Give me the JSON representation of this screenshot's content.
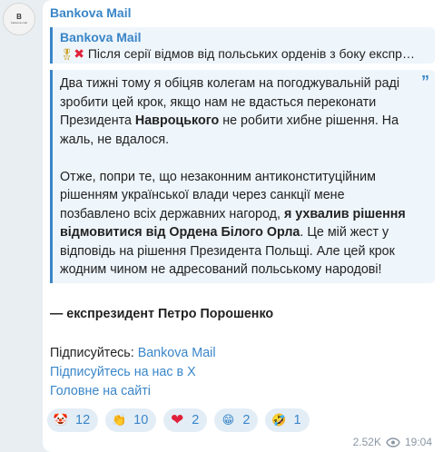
{
  "channel": {
    "avatar_text": "B",
    "avatar_sub": "bankova mail"
  },
  "post": {
    "sender": "Bankova Mail",
    "reply": {
      "title": "Bankova Mail",
      "text": "Після серії відмов від польських орденів з боку експр…"
    },
    "quote": {
      "p1_a": "Два тижні тому я обіцяв колегам на погоджувальній раді зробити цей крок, якщо нам не вдасться переконати Президента ",
      "p1_bold": "Навроцького",
      "p1_b": " не робити хибне рішення. На жаль, не вдалося.",
      "p2_a": "Отже, попри те, що незаконним антиконституційним рішенням української влади через санкції мене позбавлено всіх державних нагород, ",
      "p2_bold": "я ухвалив рішення відмовитися від Ордена Білого Орла",
      "p2_b": ". Це мій жест у відповідь на рішення Президента Польщі. Але цей крок жодним чином не адресований польському народові!"
    },
    "signature": "— експрезидент Петро Порошенко",
    "subscribe_label": "Підписуйтесь: ",
    "subscribe_link": "Bankova Mail",
    "x_link": "Підписуйтесь на нас в Х",
    "site_link": "Головне на сайті"
  },
  "reactions": [
    {
      "icon": "🤡",
      "count": "12"
    },
    {
      "icon": "👏",
      "count": "10"
    },
    {
      "icon": "❤",
      "count": "2"
    },
    {
      "icon": "😁",
      "count": "2"
    },
    {
      "icon": "🤣",
      "count": "1"
    }
  ],
  "meta": {
    "views": "2.52K",
    "time": "19:04"
  }
}
